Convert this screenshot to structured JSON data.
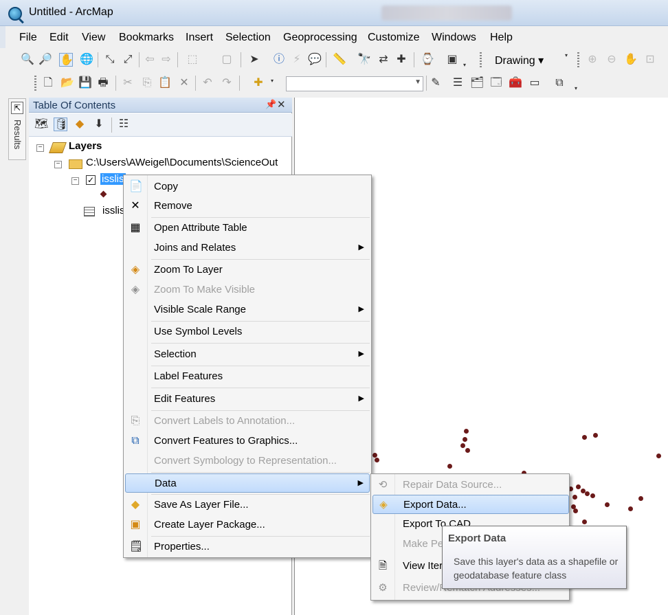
{
  "window": {
    "title": "Untitled - ArcMap"
  },
  "menubar": [
    "File",
    "Edit",
    "View",
    "Bookmarks",
    "Insert",
    "Selection",
    "Geoprocessing",
    "Customize",
    "Windows",
    "Help"
  ],
  "toolbar": {
    "drawing_label": "Drawing ▾"
  },
  "results_tab": {
    "label": "Results"
  },
  "toc": {
    "title": "Table Of Contents",
    "pin_icon": "pin-icon",
    "close_label": "✕",
    "root": "Layers",
    "folder": "C:\\Users\\AWeigel\\Documents\\ScienceOut",
    "layer": "isslis",
    "table": "isslis"
  },
  "context_menu": {
    "items": [
      {
        "label": "Copy",
        "icon": "copy-icon"
      },
      {
        "label": "Remove",
        "icon": "remove-icon"
      },
      {
        "label": "Open Attribute Table",
        "icon": "attribute-table-icon"
      },
      {
        "label": "Joins and Relates",
        "submenu": true
      },
      {
        "label": "Zoom To Layer",
        "icon": "zoom-to-layer-icon"
      },
      {
        "label": "Zoom To Make Visible",
        "icon": "zoom-visible-icon",
        "disabled": true
      },
      {
        "label": "Visible Scale Range",
        "submenu": true
      },
      {
        "label": "Use Symbol Levels"
      },
      {
        "label": "Selection",
        "submenu": true
      },
      {
        "label": "Label Features"
      },
      {
        "label": "Edit Features",
        "submenu": true
      },
      {
        "label": "Convert Labels to Annotation...",
        "icon": "convert-labels-icon",
        "disabled": true
      },
      {
        "label": "Convert Features to Graphics...",
        "icon": "convert-features-icon"
      },
      {
        "label": "Convert Symbology to Representation...",
        "disabled": true
      },
      {
        "label": "Data",
        "submenu": true,
        "highlighted": true
      },
      {
        "label": "Save As Layer File...",
        "icon": "save-layer-icon"
      },
      {
        "label": "Create Layer Package...",
        "icon": "layer-package-icon"
      },
      {
        "label": "Properties...",
        "icon": "properties-icon"
      }
    ]
  },
  "data_submenu": {
    "items": [
      {
        "label": "Repair Data Source...",
        "disabled": true
      },
      {
        "label": "Export Data...",
        "highlighted": true
      },
      {
        "label": "Export To CAD"
      },
      {
        "label": "Make Pe",
        "disabled": true
      },
      {
        "label": "View Iter"
      },
      {
        "label": "Review/Rematch Addresses...",
        "disabled": true
      }
    ]
  },
  "tooltip": {
    "title": "Export Data",
    "body": "Save this layer's data as a shapefile or geodatabase feature class"
  },
  "colors": {
    "selection": "#3399ff",
    "menu_highlight": "#c1dbfc",
    "point_symbol": "#6b1a1a"
  }
}
